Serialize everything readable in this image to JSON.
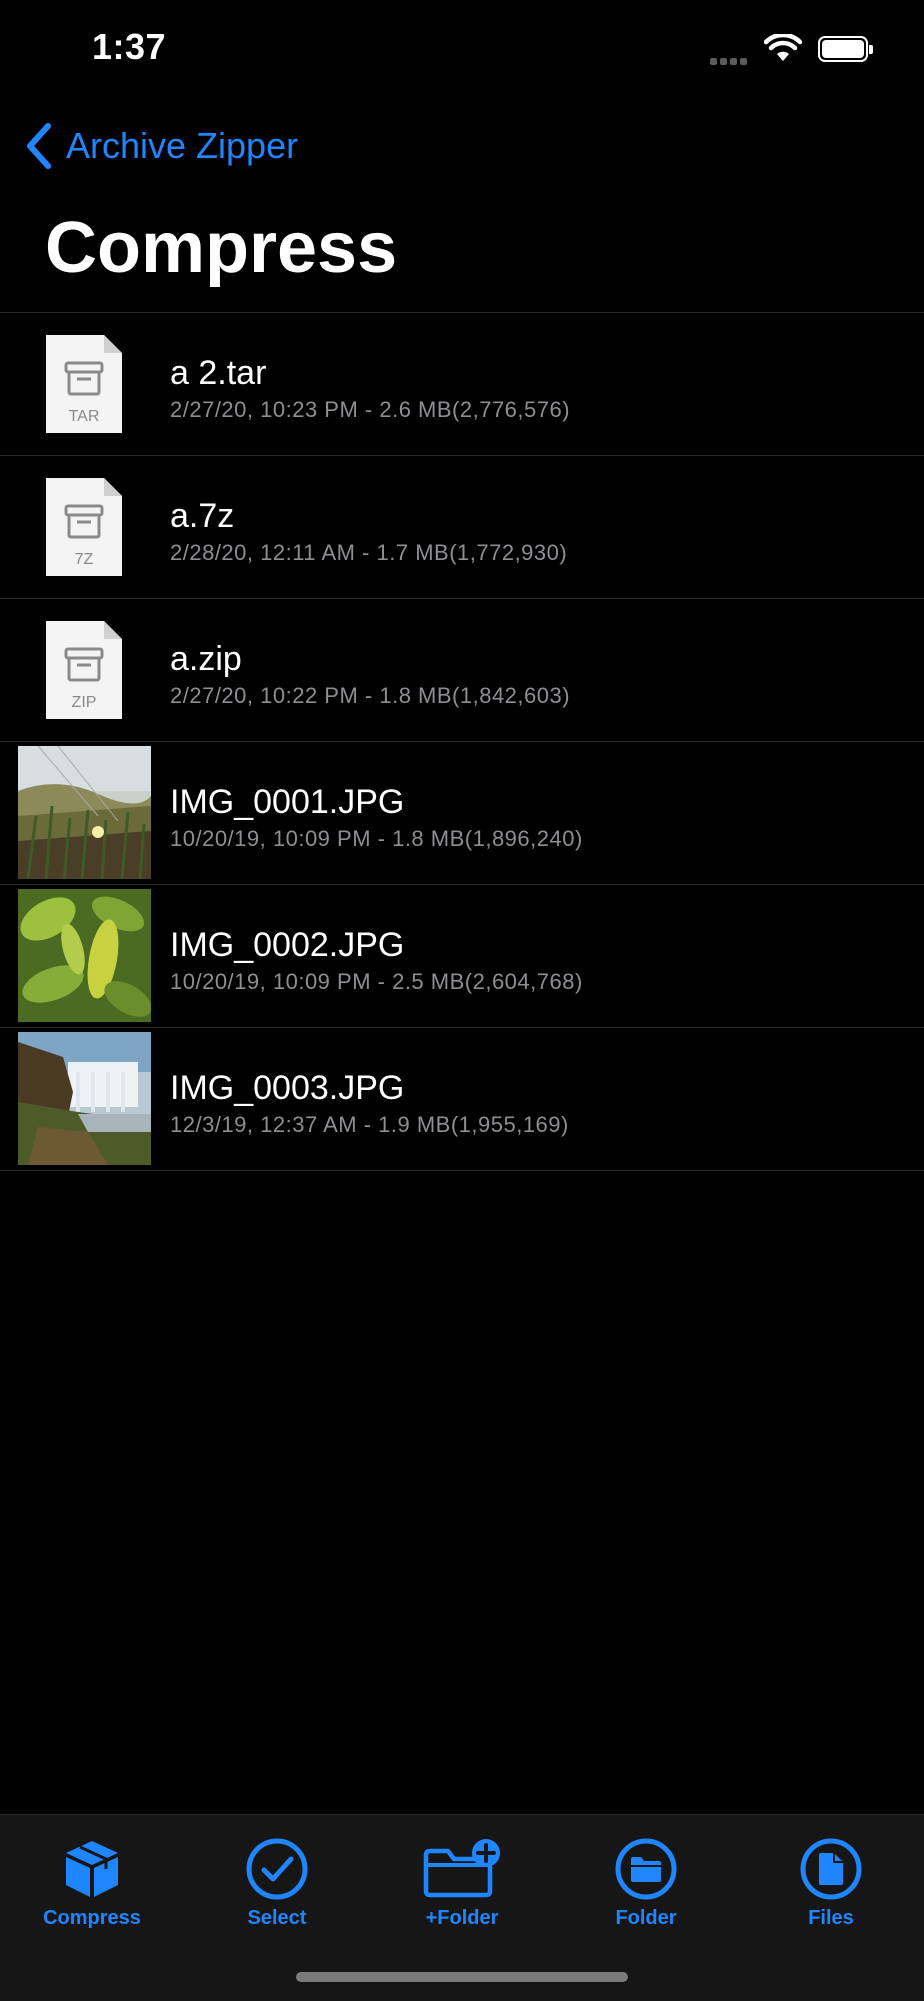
{
  "status_bar": {
    "time": "1:37"
  },
  "nav": {
    "back_label": "Archive Zipper",
    "title": "Compress"
  },
  "files": [
    {
      "name": "a 2.tar",
      "detail": "2/27/20, 10:23 PM - 2.6 MB(2,776,576)",
      "kind": "archive",
      "badge": "TAR"
    },
    {
      "name": "a.7z",
      "detail": "2/28/20, 12:11 AM - 1.7 MB(1,772,930)",
      "kind": "archive",
      "badge": "7Z"
    },
    {
      "name": "a.zip",
      "detail": "2/27/20, 10:22 PM - 1.8 MB(1,842,603)",
      "kind": "archive",
      "badge": "ZIP"
    },
    {
      "name": "IMG_0001.JPG",
      "detail": "10/20/19, 10:09 PM - 1.8 MB(1,896,240)",
      "kind": "image"
    },
    {
      "name": "IMG_0002.JPG",
      "detail": "10/20/19, 10:09 PM - 2.5 MB(2,604,768)",
      "kind": "image"
    },
    {
      "name": "IMG_0003.JPG",
      "detail": "12/3/19, 12:37 AM - 1.9 MB(1,955,169)",
      "kind": "image"
    }
  ],
  "tabbar": {
    "items": [
      {
        "label": "Compress",
        "icon": "cube-icon"
      },
      {
        "label": "Select",
        "icon": "checkmark-circle-icon"
      },
      {
        "label": "+Folder",
        "icon": "folder-plus-icon"
      },
      {
        "label": "Folder",
        "icon": "folder-circle-icon"
      },
      {
        "label": "Files",
        "icon": "document-circle-icon"
      }
    ]
  },
  "colors": {
    "accent": "#1f86ff",
    "background": "#000000",
    "secondary_text": "#8e8e93"
  }
}
